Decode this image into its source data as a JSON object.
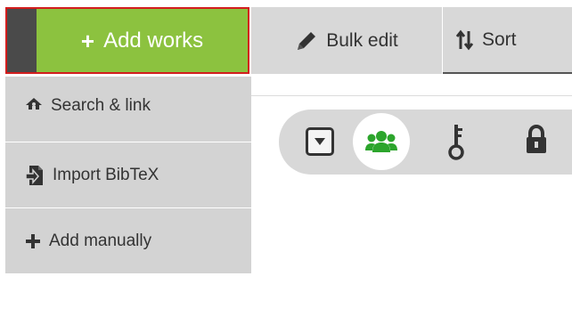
{
  "toolbar": {
    "add_works_label": "Add works",
    "bulk_edit_label": "Bulk edit",
    "sort_label": "Sort"
  },
  "add_menu": {
    "items": [
      {
        "label": "Search & link",
        "icon": "search-link-icon"
      },
      {
        "label": "Import BibTeX",
        "icon": "import-icon"
      },
      {
        "label": "Add manually",
        "icon": "plus-icon"
      }
    ]
  },
  "privacy_icons": [
    "dropdown-toggle-icon",
    "public-group-icon",
    "limited-key-icon",
    "private-lock-icon"
  ],
  "colors": {
    "add_button": "#8cc23f",
    "add_button_border": "#d21d1d",
    "add_button_stripe": "#4a4a4a",
    "public_icon": "#2ca52c",
    "button_gray": "#d8d8d8",
    "menu_gray": "#d3d3d3",
    "text": "#333333"
  }
}
